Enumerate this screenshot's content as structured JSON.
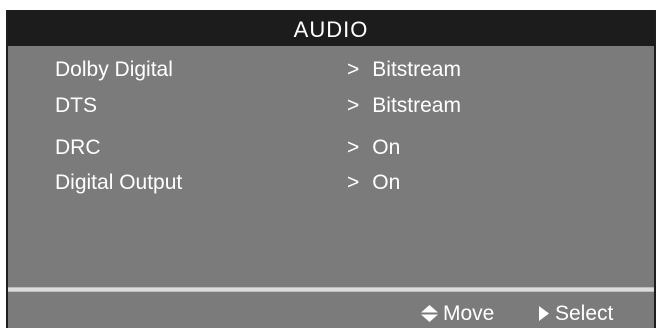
{
  "menu": {
    "title": "AUDIO",
    "items": [
      {
        "label": "Dolby Digital",
        "arrow": ">",
        "value": "Bitstream"
      },
      {
        "label": "DTS",
        "arrow": ">",
        "value": "Bitstream"
      },
      {
        "label": "DRC",
        "arrow": ">",
        "value": "On"
      },
      {
        "label": "Digital Output",
        "arrow": ">",
        "value": "On"
      }
    ]
  },
  "footer": {
    "move": {
      "icon": "up-down-arrows-icon",
      "label": "Move"
    },
    "select": {
      "icon": "right-triangle-icon",
      "label": "Select"
    }
  },
  "colors": {
    "panel": "#7a7b7a",
    "title_bar": "#1c1c1c",
    "text": "#ffffff"
  }
}
